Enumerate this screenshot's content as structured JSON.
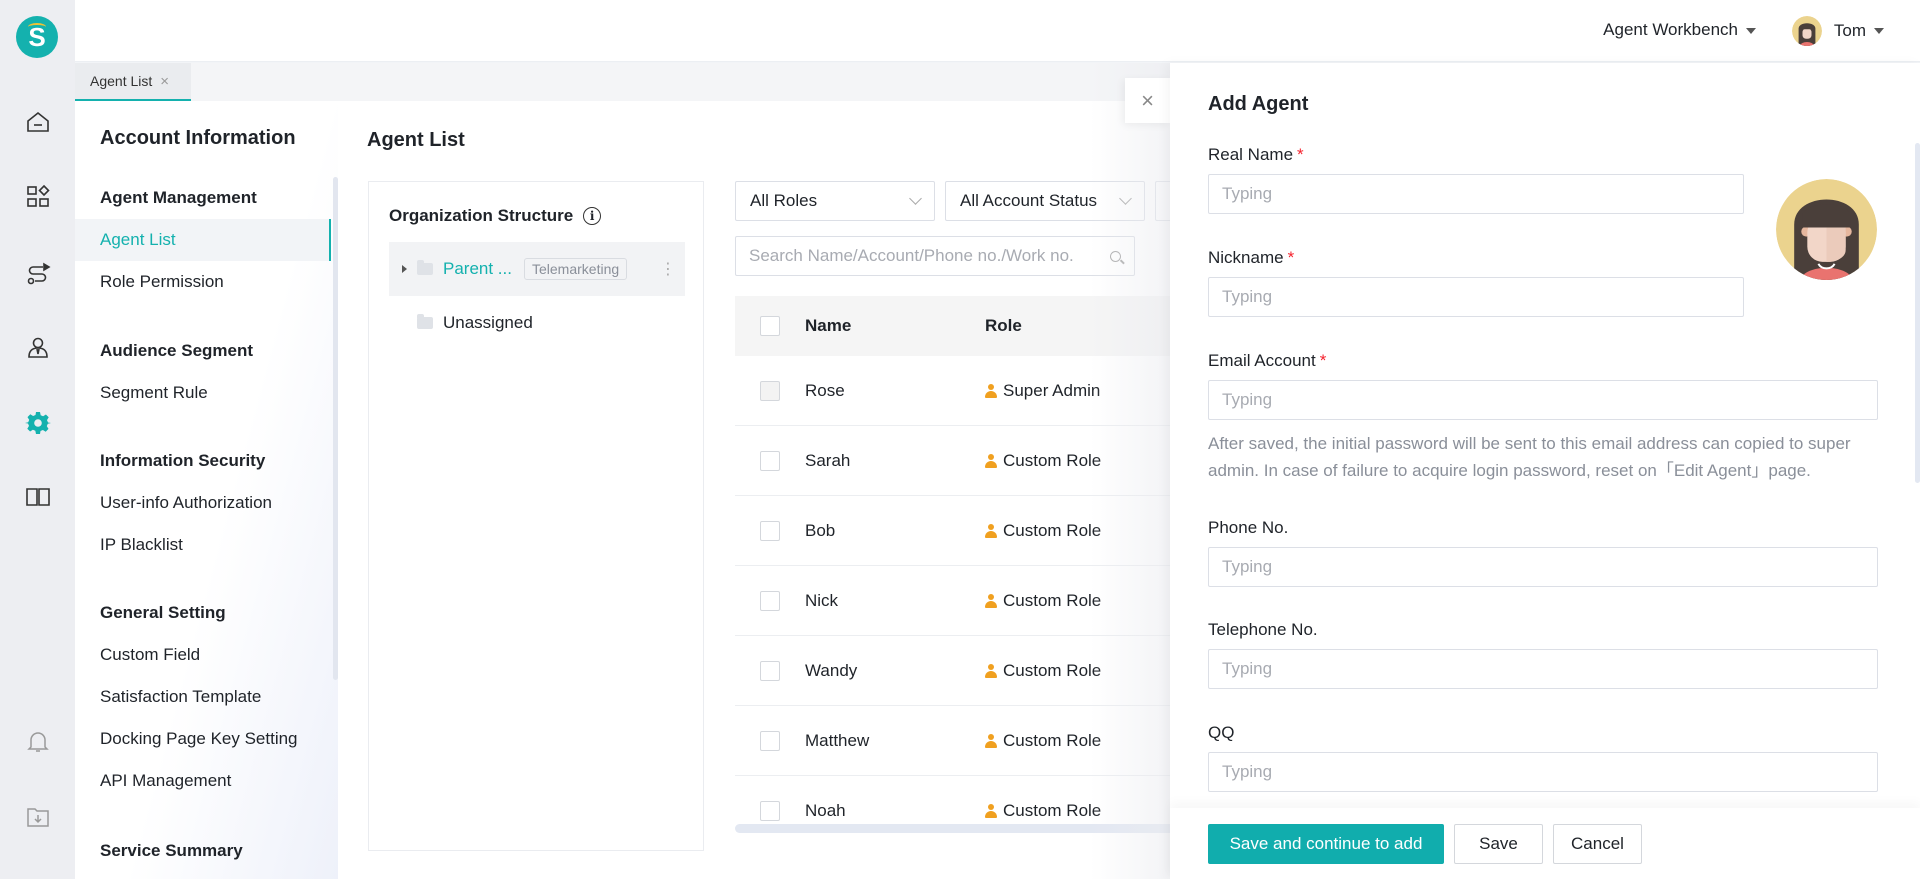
{
  "app": {
    "logo_letter": "S",
    "accent": "#14b1ae"
  },
  "rail": {
    "items": [
      {
        "name": "home-icon"
      },
      {
        "name": "apps-icon"
      },
      {
        "name": "route-icon"
      },
      {
        "name": "agent-icon"
      },
      {
        "name": "settings-icon",
        "active": true
      },
      {
        "name": "book-icon"
      },
      {
        "name": "bell-icon"
      },
      {
        "name": "download-folder-icon"
      }
    ]
  },
  "header": {
    "workbench": "Agent Workbench",
    "user": "Tom"
  },
  "tabs": [
    {
      "label": "Agent List",
      "close": "×"
    }
  ],
  "subnav": {
    "title": "Account Information",
    "groups": [
      {
        "label": "Agent Management",
        "items": [
          "Agent List",
          "Role Permission"
        ]
      },
      {
        "label": "Audience Segment",
        "items": [
          "Segment Rule"
        ]
      },
      {
        "label": "Information Security",
        "items": [
          "User-info Authorization",
          "IP Blacklist"
        ]
      },
      {
        "label": "General Setting",
        "items": [
          "Custom Field",
          "Satisfaction Template",
          "Docking Page Key Setting",
          "API Management"
        ]
      },
      {
        "label": "Service Summary",
        "items": []
      }
    ],
    "active": "Agent List"
  },
  "main": {
    "title": "Agent List",
    "org": {
      "title": "Organization Structure",
      "info": "i",
      "nodes": [
        {
          "label": "Parent ...",
          "tag": "Telemarketing",
          "selected": true
        },
        {
          "label": "Unassigned"
        }
      ]
    },
    "filters": {
      "role": "All Roles",
      "status": "All Account Status"
    },
    "search": {
      "placeholder": "Search Name/Account/Phone no./Work no."
    },
    "table": {
      "columns": [
        "Name",
        "Role"
      ],
      "rows": [
        {
          "name": "Rose",
          "role": "Super Admin",
          "disabled": true
        },
        {
          "name": "Sarah",
          "role": "Custom Role"
        },
        {
          "name": "Bob",
          "role": "Custom Role"
        },
        {
          "name": "Nick",
          "role": "Custom Role"
        },
        {
          "name": "Wandy",
          "role": "Custom Role"
        },
        {
          "name": "Matthew",
          "role": "Custom Role"
        },
        {
          "name": "Noah",
          "role": "Custom Role"
        }
      ]
    }
  },
  "drawer": {
    "close": "×",
    "title": "Add Agent",
    "fields": {
      "real_name": {
        "label": "Real Name",
        "required": "*",
        "placeholder": "Typing"
      },
      "nickname": {
        "label": "Nickname",
        "required": "*",
        "placeholder": "Typing"
      },
      "email": {
        "label": "Email Account",
        "required": "*",
        "placeholder": "Typing"
      },
      "phone": {
        "label": "Phone No.",
        "placeholder": "Typing"
      },
      "telephone": {
        "label": "Telephone No.",
        "placeholder": "Typing"
      },
      "qq": {
        "label": "QQ",
        "placeholder": "Typing"
      }
    },
    "email_hint": "After saved, the initial password will be sent to this email address can copied to super admin. In case of failure to acquire login password, reset on「Edit Agent」page.",
    "buttons": {
      "save_continue": "Save and continue to add",
      "save": "Save",
      "cancel": "Cancel"
    }
  }
}
